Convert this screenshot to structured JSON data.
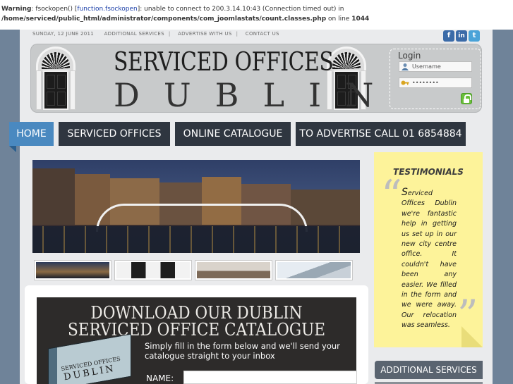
{
  "warning": {
    "prefix": "Warning",
    "part1": ": fsockopen() [",
    "link": "function.fsockopen",
    "part2": "]: unable to connect to 200.3.14.10:43 (Connection timed out) in",
    "path": "/home/serviced/public_html/administrator/components/com_joomlastats/count.classes.php",
    "online": " on line ",
    "line": "1044"
  },
  "topnav": {
    "date": "SUNDAY, 12 JUNE 2011",
    "items": [
      "ADDITIONAL SERVICES",
      "ADVERTISE WITH US",
      "CONTACT US"
    ],
    "separator": "|"
  },
  "social": [
    "f",
    "in",
    "t"
  ],
  "logo": {
    "line1": "SERVICED OFFICES",
    "line2": "DUBLIN"
  },
  "login": {
    "title": "Login",
    "username": "Username",
    "password": "••••••••"
  },
  "nav": {
    "items": [
      "HOME",
      "SERVICED OFFICES",
      "ONLINE CATALOGUE",
      "TO ADVERTISE CALL 01 6854884"
    ],
    "active": "HOME"
  },
  "download": {
    "title_line1": "DOWNLOAD OUR DUBLIN",
    "title_line2": "SERVICED OFFICE CATALOGUE",
    "text": "Simply fill in the form below and we'll send your catalogue straight to your inbox",
    "book_line1": "SERVICED OFFICES",
    "book_line2": "DUBLIN",
    "name_label": "NAME:"
  },
  "testimonials": {
    "title": "TESTIMONIALS",
    "open_quote": "“",
    "close_quote": "”",
    "first_letter": "S",
    "text": "erviced Offices Dublin we're fantastic help in getting us set up in our new city centre office. It couldn't have been any easier. We filled in the form and we were away. Our relocation was seamless."
  },
  "sidebar": {
    "button": "ADDITIONAL SERVICES"
  },
  "colors": {
    "active_nav": "#4a89c0",
    "nav": "#2f3640",
    "testimonial_bg": "#fdf39a",
    "background": "#6f8399"
  }
}
